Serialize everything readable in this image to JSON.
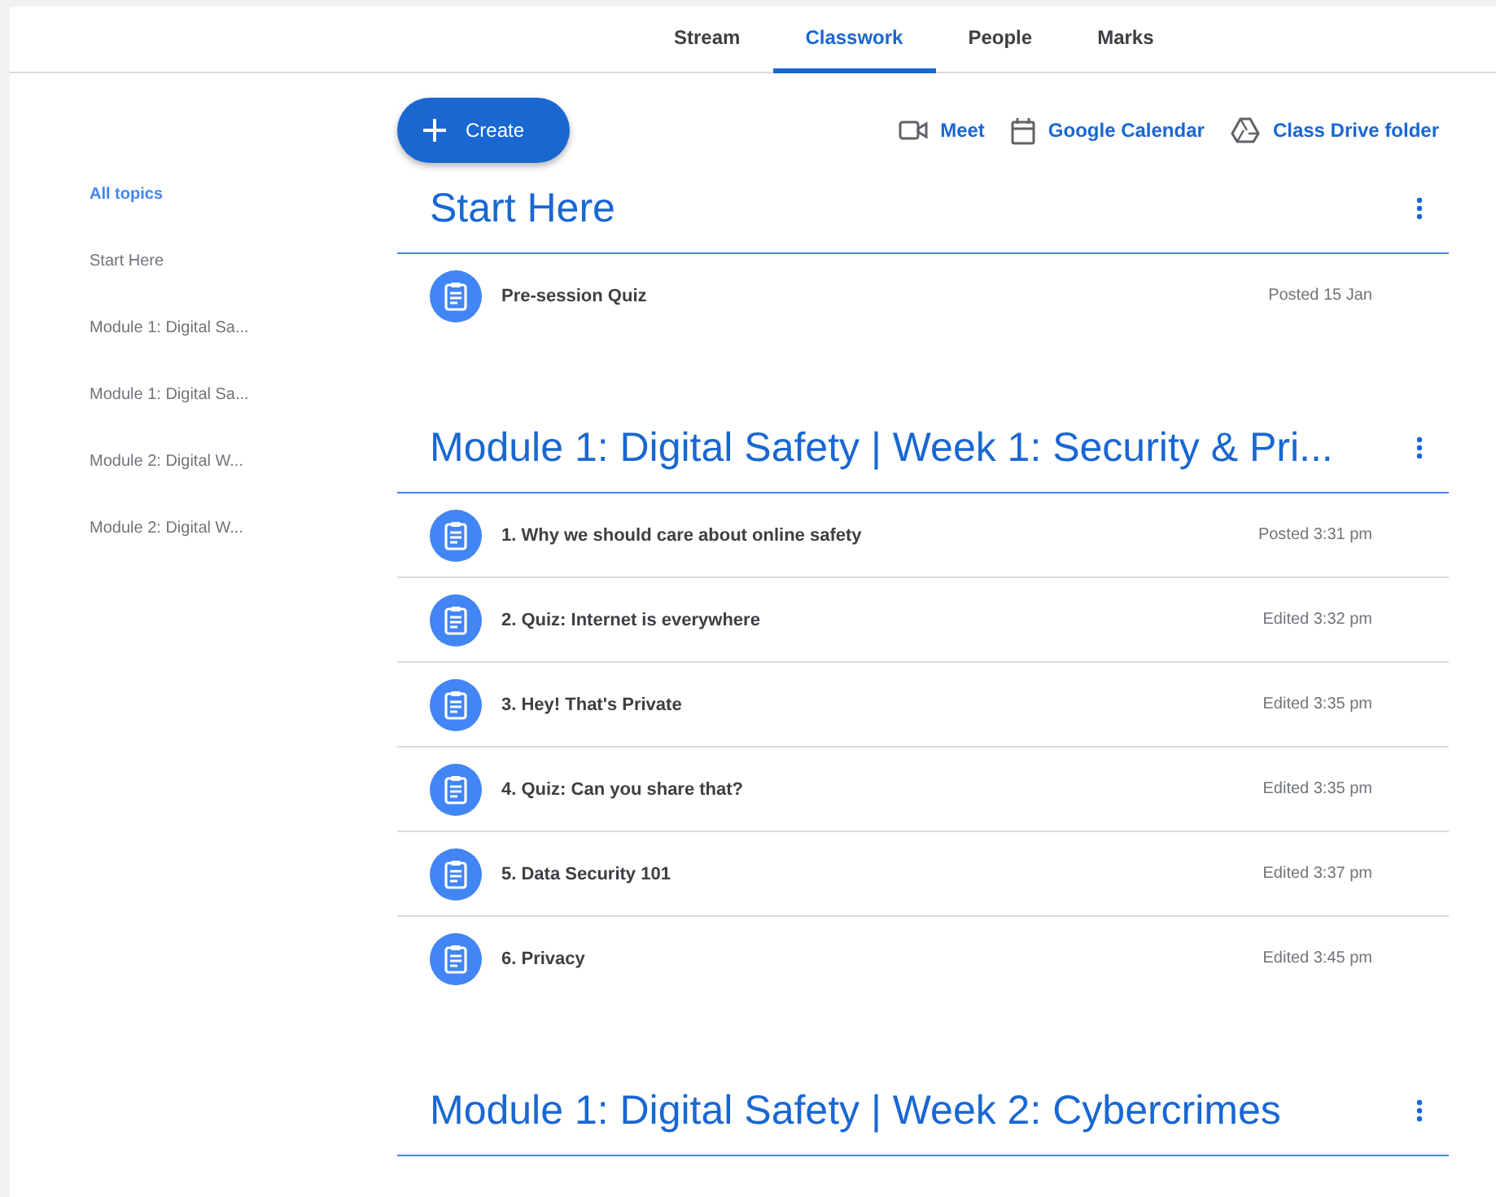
{
  "tabs": [
    {
      "label": "Stream",
      "selected": false
    },
    {
      "label": "Classwork",
      "selected": true
    },
    {
      "label": "People",
      "selected": false
    },
    {
      "label": "Marks",
      "selected": false
    }
  ],
  "create_button": {
    "label": "Create"
  },
  "links": [
    {
      "kind": "meet",
      "label": "Meet"
    },
    {
      "kind": "calendar",
      "label": "Google Calendar"
    },
    {
      "kind": "drive",
      "label": "Class Drive folder"
    }
  ],
  "sidebar": {
    "items": [
      {
        "label": "All topics",
        "selected": true
      },
      {
        "label": "Start Here",
        "selected": false
      },
      {
        "label": "Module 1: Digital Sa...",
        "selected": false
      },
      {
        "label": "Module 1: Digital Sa...",
        "selected": false
      },
      {
        "label": "Module 2: Digital W...",
        "selected": false
      },
      {
        "label": "Module 2: Digital W...",
        "selected": false
      }
    ]
  },
  "topics": [
    {
      "title": "Start Here",
      "items": [
        {
          "title": "Pre-session Quiz",
          "time": "Posted 15 Jan"
        }
      ]
    },
    {
      "title": "Module 1: Digital Safety | Week 1: Security & Pri...",
      "items": [
        {
          "title": "1. Why we should care about online safety",
          "time": "Posted 3:31 pm"
        },
        {
          "title": "2. Quiz: Internet is everywhere",
          "time": "Edited 3:32 pm"
        },
        {
          "title": "3. Hey! That's Private",
          "time": "Edited 3:35 pm"
        },
        {
          "title": "4. Quiz: Can you share that?",
          "time": "Edited 3:35 pm"
        },
        {
          "title": "5. Data Security 101",
          "time": "Edited 3:37 pm"
        },
        {
          "title": "6. Privacy",
          "time": "Edited 3:45 pm"
        }
      ]
    },
    {
      "title": "Module 1: Digital Safety | Week 2: Cybercrimes"
    }
  ]
}
